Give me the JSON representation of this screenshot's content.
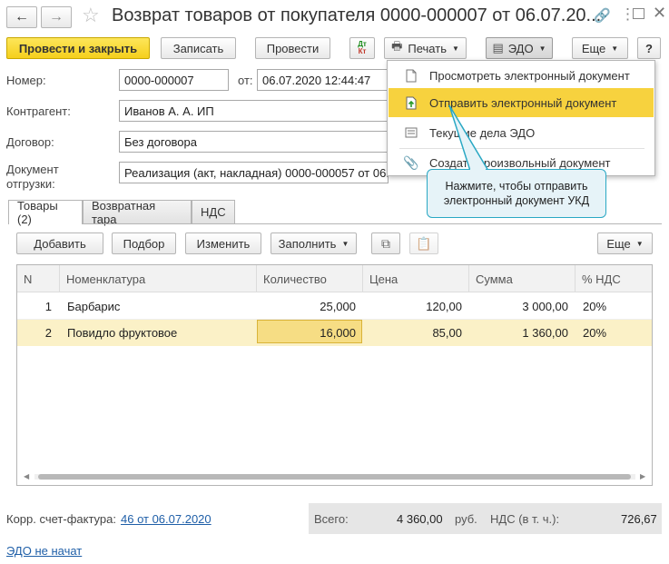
{
  "window": {
    "title": "Возврат товаров от покупателя 0000-000007 от 06.07.20..."
  },
  "toolbar": {
    "post_close": "Провести и закрыть",
    "save": "Записать",
    "post": "Провести",
    "dt_kt": "Дт\nКт",
    "print": "Печать",
    "edo": "ЭДО",
    "more": "Еще",
    "help": "?"
  },
  "form": {
    "number_label": "Номер:",
    "number_value": "0000-000007",
    "date_label": "от:",
    "date_value": "06.07.2020 12:44:47",
    "counterparty_label": "Контрагент:",
    "counterparty_value": "Иванов А. А. ИП",
    "contract_label": "Договор:",
    "contract_value": "Без договора",
    "shipment_label_1": "Документ",
    "shipment_label_2": "отгрузки:",
    "shipment_value": "Реализация (акт, накладная) 0000-000057 от 06.0"
  },
  "edo_menu": {
    "items": [
      {
        "label": "Просмотреть электронный документ",
        "icon": "document-icon"
      },
      {
        "label": "Отправить электронный документ",
        "icon": "send-document-icon"
      },
      {
        "label": "Текущие дела ЭДО",
        "icon": "tasks-icon"
      },
      {
        "label": "Создать произвольный документ",
        "icon": "paperclip-icon"
      }
    ]
  },
  "tooltip": {
    "text": "Нажмите, чтобы отправить электронный документ УКД"
  },
  "tabs": [
    "Товары (2)",
    "Возвратная тара",
    "НДС"
  ],
  "table_toolbar": {
    "add": "Добавить",
    "select": "Подбор",
    "change": "Изменить",
    "fill": "Заполнить",
    "more": "Еще"
  },
  "table": {
    "columns": [
      "N",
      "Номенклатура",
      "Количество",
      "Цена",
      "Сумма",
      "% НДС"
    ],
    "rows": [
      {
        "n": "1",
        "name": "Барбарис",
        "qty": "25,000",
        "price": "120,00",
        "sum": "3 000,00",
        "vat": "20%"
      },
      {
        "n": "2",
        "name": "Повидло фруктовое",
        "qty": "16,000",
        "price": "85,00",
        "sum": "1 360,00",
        "vat": "20%"
      }
    ]
  },
  "footer": {
    "invoice_label": "Корр. счет-фактура:",
    "invoice_link": "46 от 06.07.2020",
    "total_label": "Всего:",
    "total_value": "4 360,00",
    "currency": "руб.",
    "vat_label": "НДС (в т. ч.):",
    "vat_value": "726,67",
    "edo_status": "ЭДО не начат"
  },
  "colors": {
    "accent_yellow": "#f5d01c",
    "selected_row": "#fbf1c7",
    "tooltip_bg": "#e6f3f8",
    "tooltip_border": "#2aa8c4",
    "link": "#1f5fa8"
  }
}
